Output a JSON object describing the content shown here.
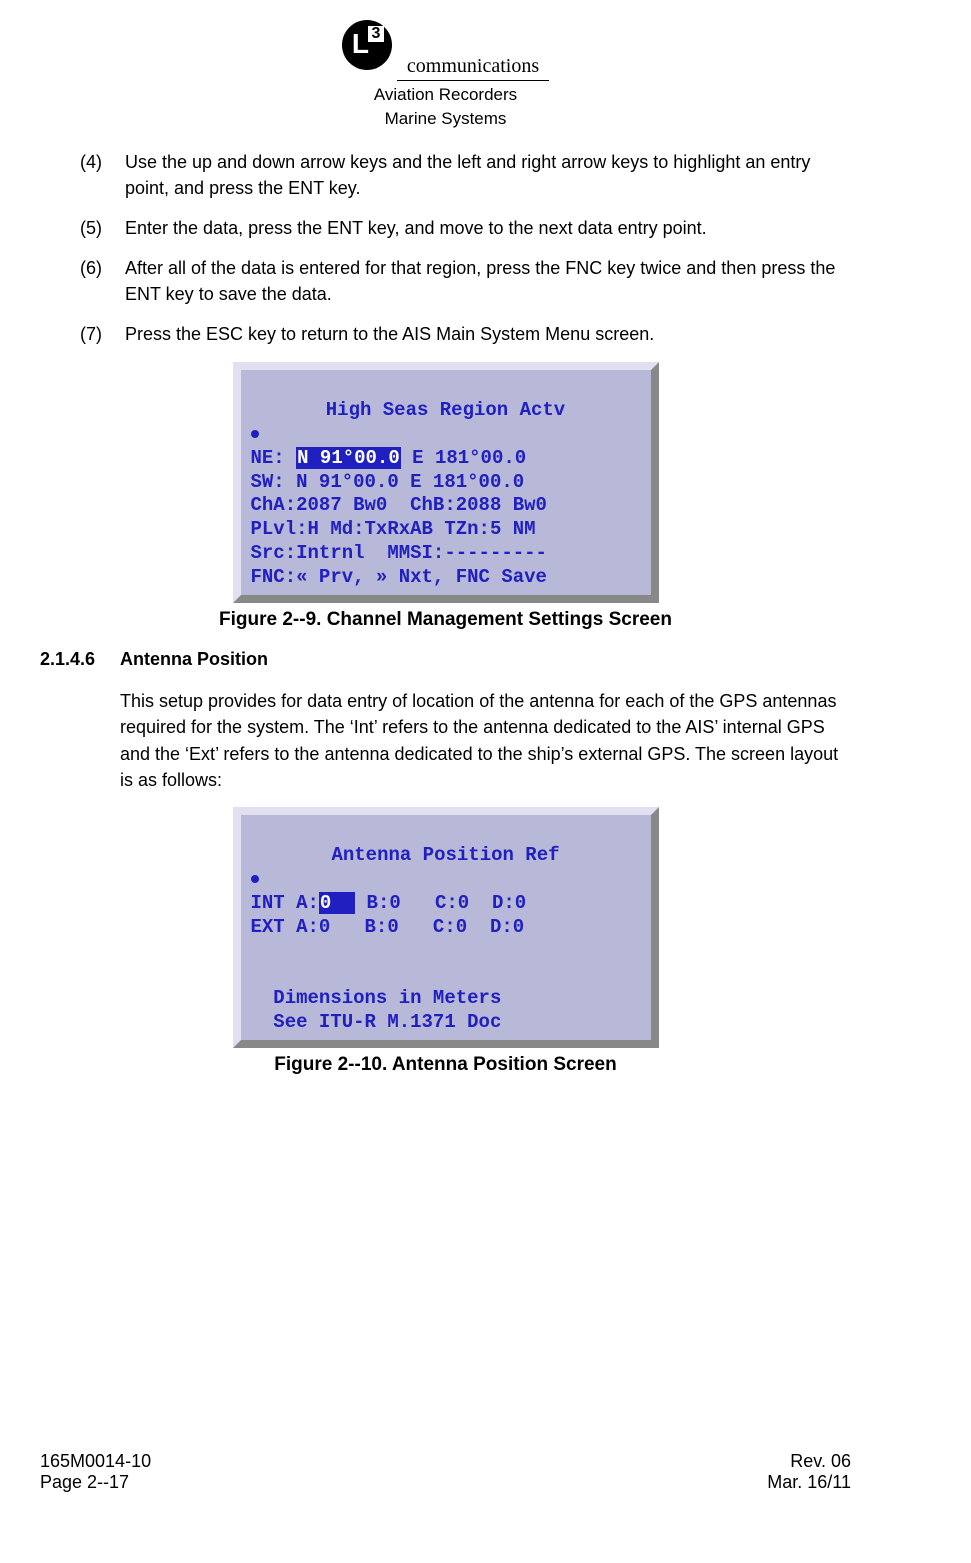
{
  "header": {
    "logo_letter": "L",
    "logo_num": "3",
    "comm": "communications",
    "sub1": "Aviation Recorders",
    "sub2": "Marine Systems"
  },
  "steps": {
    "s4_num": "(4)",
    "s4_text": "Use the up and down arrow keys and the left and right arrow keys to highlight an entry point, and press the ENT key.",
    "s5_num": "(5)",
    "s5_text": "Enter the data, press the ENT key, and move to the next data entry point.",
    "s6_num": "(6)",
    "s6_text": "After all of the data is entered for that region, press the FNC key twice and then press the ENT key to save the data.",
    "s7_num": "(7)",
    "s7_text": "Press the ESC key to return to the AIS Main System Menu screen."
  },
  "screen1": {
    "title": "High Seas Region Actv",
    "ne_pre": "NE: ",
    "ne_hl": "N 91°00.0",
    "ne_post": " E 181°00.0",
    "sw": "SW: N 91°00.0 E 181°00.0",
    "ch": "ChA:2087 Bw0  ChB:2088 Bw0",
    "plvl": "PLvl:H Md:TxRxAB TZn:5 NM",
    "src": "Src:Intrnl  MMSI:---------",
    "fnc": "FNC:« Prv, » Nxt, FNC Save"
  },
  "caption1": "Figure 2--9.  Channel Management Settings Screen",
  "section": {
    "num": "2.1.4.6",
    "title": "Antenna Position"
  },
  "para1": "This setup provides for data entry of location of the antenna for each of the GPS antennas required for the system. The ‘Int’ refers to the antenna dedicated to the AIS’ internal GPS and the ‘Ext’ refers to the antenna dedicated to the ship’s external GPS. The screen layout is as follows:",
  "screen2": {
    "title": "Antenna Position Ref",
    "int_pre": "INT A:",
    "int_hl": "0  ",
    "int_post": " B:0   C:0  D:0",
    "ext": "EXT A:0   B:0   C:0  D:0",
    "blank1": " ",
    "blank2": " ",
    "dim": "  Dimensions in Meters",
    "see": "  See ITU-R M.1371 Doc"
  },
  "caption2": "Figure 2--10.  Antenna Position Screen",
  "footer": {
    "doc": "165M0014-10",
    "page": "Page 2--17",
    "rev": "Rev. 06",
    "date": "Mar. 16/11"
  }
}
